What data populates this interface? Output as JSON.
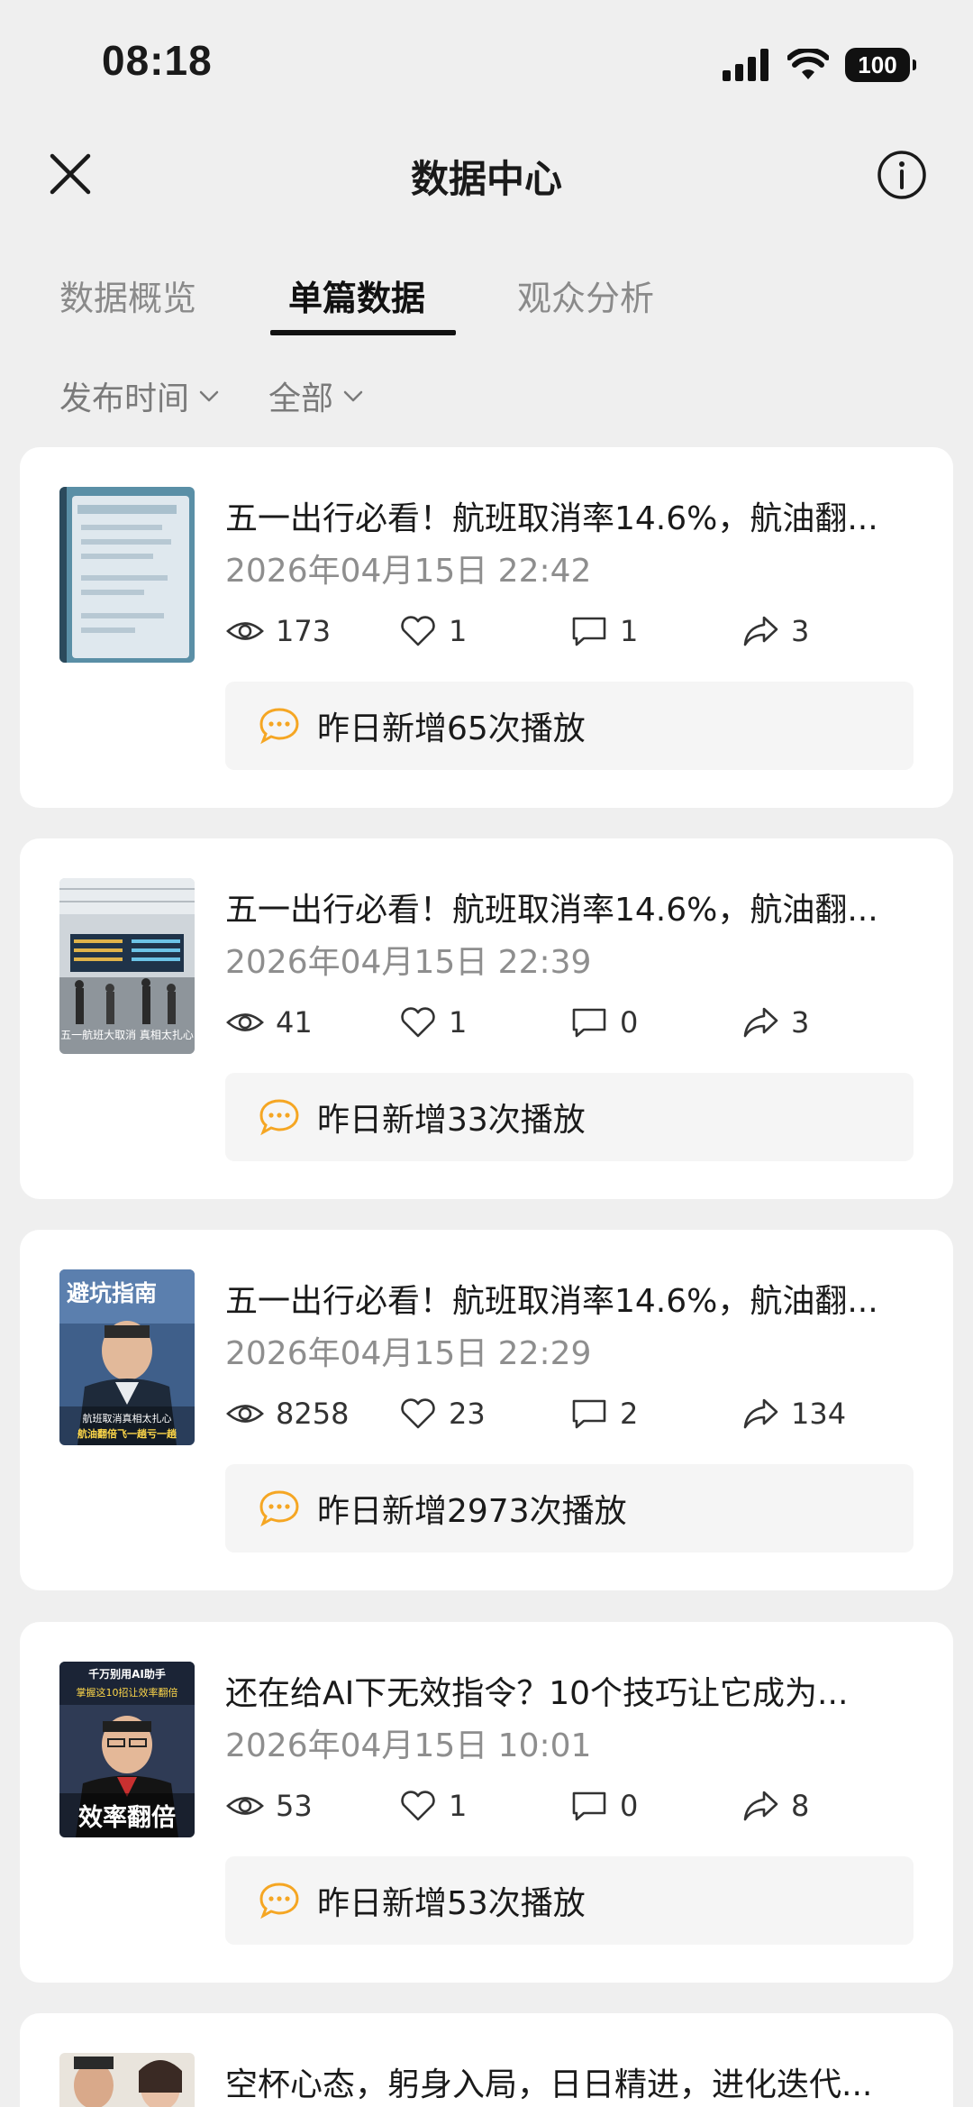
{
  "status_bar": {
    "time": "08:18",
    "battery": "100"
  },
  "nav": {
    "title": "数据中心"
  },
  "tabs": [
    {
      "label": "数据概览",
      "active": false
    },
    {
      "label": "单篇数据",
      "active": true
    },
    {
      "label": "观众分析",
      "active": false
    }
  ],
  "filters": {
    "publish_time": "发布时间",
    "scope": "全部"
  },
  "colors": {
    "accent": "#f5a623",
    "active_tab": "#111111",
    "inactive_tab": "#8a8a8a"
  },
  "posts": [
    {
      "title": "五一出行必看！航班取消率14.6%，航油翻...",
      "date": "2026年04月15日 22:42",
      "views": "173",
      "likes": "1",
      "comments": "1",
      "shares": "3",
      "notice": "昨日新增65次播放"
    },
    {
      "title": "五一出行必看！航班取消率14.6%，航油翻...",
      "date": "2026年04月15日 22:39",
      "views": "41",
      "likes": "1",
      "comments": "0",
      "shares": "3",
      "notice": "昨日新增33次播放",
      "thumb_caption": "五一航班大取消 真相太扎心"
    },
    {
      "title": "五一出行必看！航班取消率14.6%，航油翻...",
      "date": "2026年04月15日 22:29",
      "views": "8258",
      "likes": "23",
      "comments": "2",
      "shares": "134",
      "notice": "昨日新增2973次播放",
      "thumb_heading": "避坑指南",
      "thumb_caption_1": "航班取消真相太扎心",
      "thumb_caption_2": "航油翻倍飞一趟亏一趟"
    },
    {
      "title": "还在给AI下无效指令？10个技巧让它成为...",
      "date": "2026年04月15日 10:01",
      "views": "53",
      "likes": "1",
      "comments": "0",
      "shares": "8",
      "notice": "昨日新增53次播放",
      "thumb_heading": "千万别用AI助手",
      "thumb_caption_1": "掌握这10招让效率翻倍",
      "thumb_banner": "效率翻倍"
    },
    {
      "title": "空杯心态，躬身入局，日日精进，进化迭代..."
    }
  ]
}
